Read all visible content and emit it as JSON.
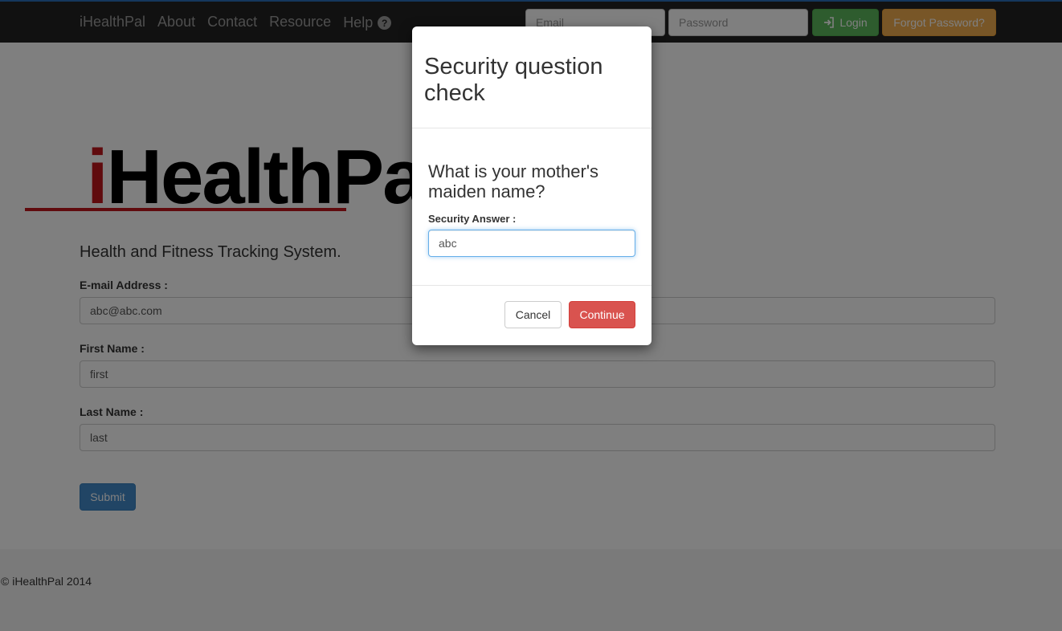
{
  "navbar": {
    "brand": "iHealthPal",
    "links": [
      "About",
      "Contact",
      "Resource"
    ],
    "help_label": "Help",
    "help_icon": "question-circle-icon",
    "email_placeholder": "Email",
    "password_placeholder": "Password",
    "login_label": "Login",
    "login_icon": "sign-in-icon",
    "forgot_label": "Forgot Password?"
  },
  "main": {
    "logo_prefix": "i",
    "logo_rest": "HealthPal",
    "tagline": "Health and Fitness Tracking System.",
    "fields": [
      {
        "label": "E-mail Address :",
        "value": "abc@abc.com"
      },
      {
        "label": "First Name :",
        "value": "first"
      },
      {
        "label": "Last Name :",
        "value": "last"
      }
    ],
    "submit_label": "Submit"
  },
  "footer": {
    "text": "© iHealthPal 2014"
  },
  "modal": {
    "title": "Security question check",
    "question": "What is your mother's maiden name?",
    "answer_label": "Security Answer :",
    "answer_value": "abc",
    "cancel_label": "Cancel",
    "continue_label": "Continue"
  },
  "colors": {
    "navbar_bg": "#222222",
    "login_green": "#5cb85c",
    "forgot_orange": "#f0ad4e",
    "submit_blue": "#428bca",
    "continue_red": "#d9534f",
    "logo_red": "#c0161d"
  }
}
